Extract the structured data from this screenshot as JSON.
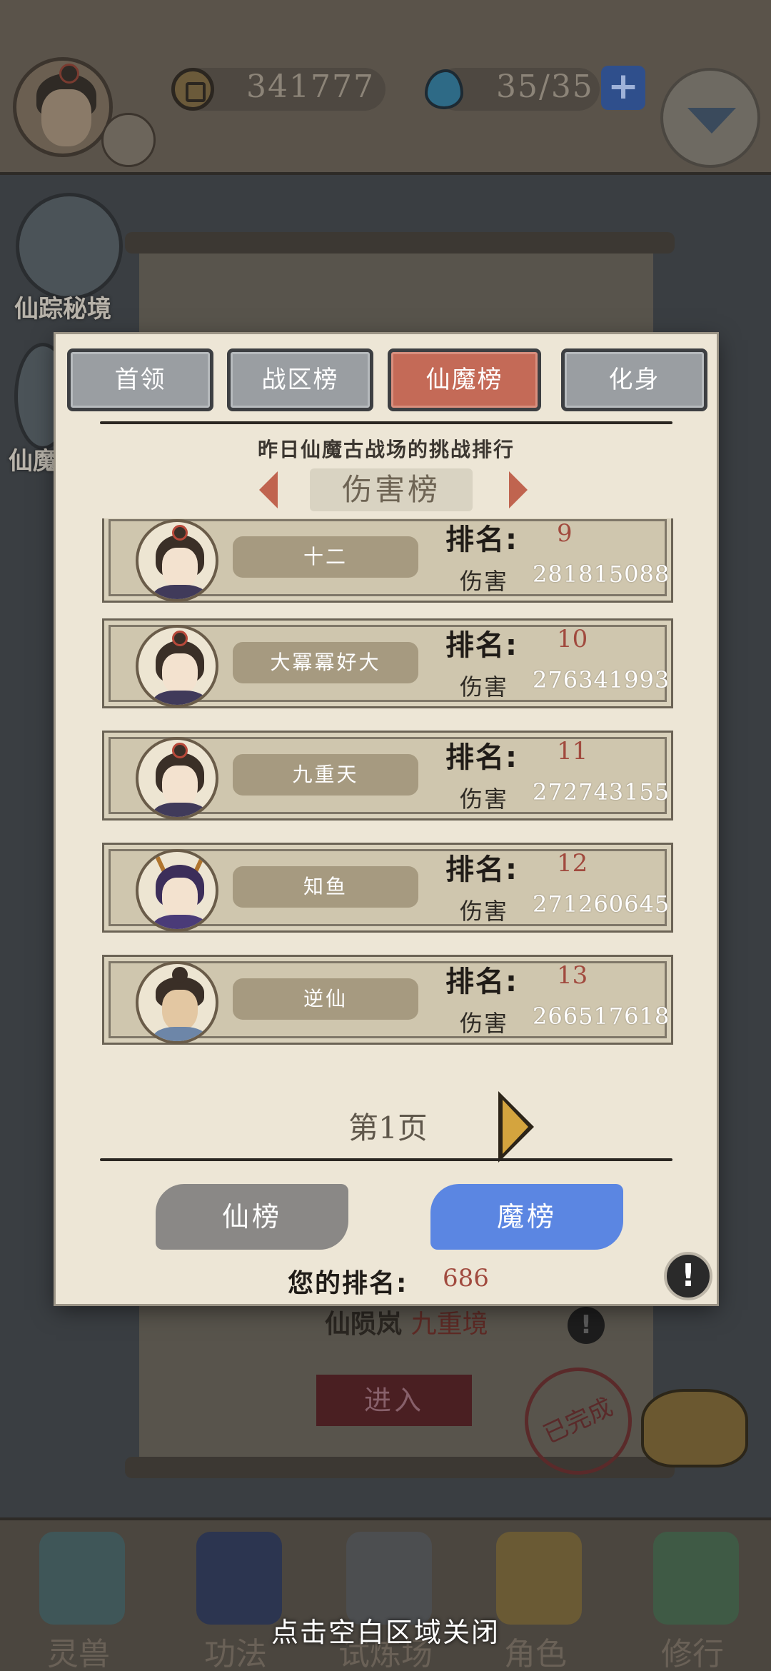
{
  "topbar": {
    "coins": "341777",
    "stamina": "35/35",
    "plus_symbol": "+"
  },
  "side": {
    "item1": "仙踪秘境",
    "item2_partial": "仙魔"
  },
  "background_stage": {
    "stage_name": "仙陨岚",
    "stage_level": "九重境",
    "enter_label": "进入",
    "done_stamp": "已完成",
    "info_symbol": "!"
  },
  "bottom_nav": [
    {
      "label": "灵兽"
    },
    {
      "label": "功法"
    },
    {
      "label": "试炼场"
    },
    {
      "label": "角色"
    },
    {
      "label": "修行"
    }
  ],
  "close_hint": "点击空白区域关闭",
  "modal": {
    "tabs": [
      {
        "label": "首领",
        "active": false
      },
      {
        "label": "战区榜",
        "active": false
      },
      {
        "label": "仙魔榜",
        "active": true
      },
      {
        "label": "化身",
        "active": false
      }
    ],
    "subtitle": "昨日仙魔古战场的挑战排行",
    "category": "伤害榜",
    "rank_label": "排名:",
    "damage_label": "伤害",
    "rows": [
      {
        "name": "十二",
        "rank": "9",
        "damage": "281815088",
        "avatar": "female-bun"
      },
      {
        "name": "大冪冪好大",
        "rank": "10",
        "damage": "276341993",
        "avatar": "female-bun"
      },
      {
        "name": "九重天",
        "rank": "11",
        "damage": "272743155",
        "avatar": "female-bun"
      },
      {
        "name": "知鱼",
        "rank": "12",
        "damage": "271260645",
        "avatar": "female-horned-purple"
      },
      {
        "name": "逆仙",
        "rank": "13",
        "damage": "266517618",
        "avatar": "male-topknot"
      }
    ],
    "page_label": "第1页",
    "xian_button": "仙榜",
    "mo_button": "魔榜",
    "my_rank_label": "您的排名:",
    "my_rank_value": "686",
    "info_symbol": "!"
  },
  "colors": {
    "active_tab": "#c46a57",
    "inactive_tab": "#9a9ea2",
    "rank_value": "#a14a3e",
    "mo_button": "#5b86e2",
    "xian_button": "#8a8886",
    "panel": "#ede6d6"
  }
}
